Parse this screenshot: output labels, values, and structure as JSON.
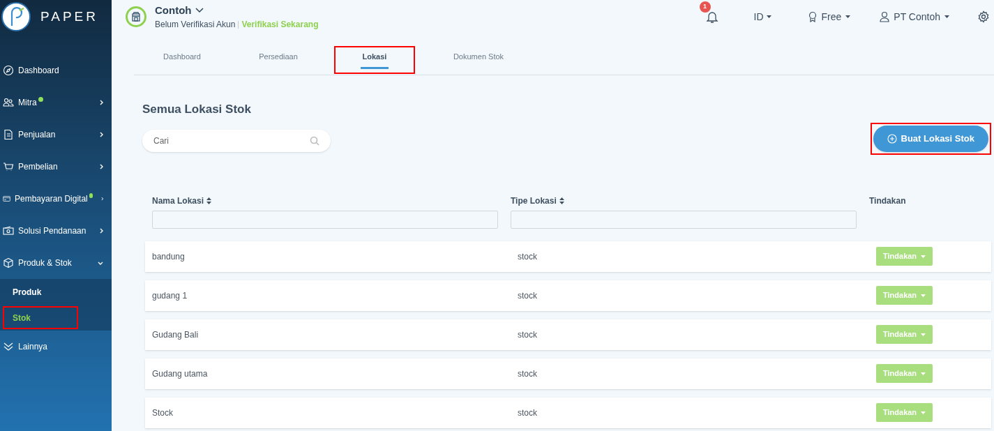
{
  "brand": {
    "name": "PAPER"
  },
  "sidebar": {
    "items": [
      {
        "kind": "link",
        "label": "Dashboard",
        "dot": false
      },
      {
        "kind": "menu",
        "label": "Mitra",
        "dot": true,
        "expanded": false
      },
      {
        "kind": "menu",
        "label": "Penjualan",
        "dot": false,
        "expanded": false
      },
      {
        "kind": "menu",
        "label": "Pembelian",
        "dot": false,
        "expanded": false
      },
      {
        "kind": "menu",
        "label": "Pembayaran Digital",
        "dot": true,
        "expanded": false
      },
      {
        "kind": "menu",
        "label": "Solusi Pendanaan",
        "dot": false,
        "expanded": false
      },
      {
        "kind": "menu",
        "label": "Produk & Stok",
        "dot": false,
        "expanded": true,
        "children": [
          {
            "label": "Produk",
            "selected": false,
            "highlighted": false
          },
          {
            "label": "Stok",
            "selected": true,
            "highlighted": true
          }
        ]
      },
      {
        "kind": "link",
        "label": "Lainnya",
        "dot": false
      }
    ]
  },
  "header": {
    "company": "Contoh",
    "status": "Belum Verifikasi Akun",
    "verify_link": "Verifikasi Sekarang",
    "notification_count": "1",
    "language": "ID",
    "plan": "Free",
    "account": "PT Contoh"
  },
  "tabs": [
    {
      "label": "Dashboard",
      "selected": false,
      "highlighted": false
    },
    {
      "label": "Persediaan",
      "selected": false,
      "highlighted": false
    },
    {
      "label": "Lokasi",
      "selected": true,
      "highlighted": true
    },
    {
      "label": "Dokumen Stok",
      "selected": false,
      "highlighted": false
    }
  ],
  "page_title": "Semua Lokasi Stok",
  "search": {
    "placeholder": "Cari"
  },
  "create_button": {
    "label": "Buat Lokasi Stok",
    "highlighted": true
  },
  "table": {
    "columns": [
      {
        "label": "Nama Lokasi",
        "sortable": true,
        "filter": true
      },
      {
        "label": "Tipe Lokasi",
        "sortable": true,
        "filter": true
      },
      {
        "label": "Tindakan",
        "sortable": false,
        "filter": false
      }
    ],
    "rows": [
      {
        "name": "bandung",
        "type": "stock",
        "action": "Tindakan"
      },
      {
        "name": "gudang 1",
        "type": "stock",
        "action": "Tindakan"
      },
      {
        "name": "Gudang Bali",
        "type": "stock",
        "action": "Tindakan"
      },
      {
        "name": "Gudang utama",
        "type": "stock",
        "action": "Tindakan"
      },
      {
        "name": "Stock",
        "type": "stock",
        "action": "Tindakan"
      }
    ]
  }
}
